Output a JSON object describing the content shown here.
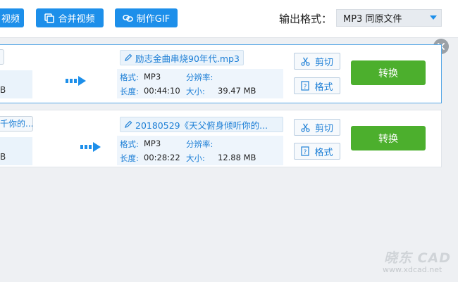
{
  "toolbar": {
    "split_video_label": "视频",
    "merge_video_label": "合并视频",
    "make_gif_label": "制作GIF",
    "output_format_label": "输出格式：",
    "output_format_value": "MP3  同原文件"
  },
  "tasks": [
    {
      "source_size_suffix": "B",
      "source_name": "",
      "output_name": "励志金曲串烧90年代.mp3",
      "format_key": "格式:",
      "format_value": "MP3",
      "resolution_key": "分辨率:",
      "resolution_value": "",
      "duration_key": "长度:",
      "duration_value": "00:44:10",
      "size_key": "大小:",
      "size_value": "39.47 MB",
      "cut_label": "剪切",
      "format_btn_label": "格式",
      "convert_label": "转换"
    },
    {
      "source_size_suffix": "B",
      "source_name": "千你的...",
      "output_name": "20180529《天父俯身倾听你的...",
      "format_key": "格式:",
      "format_value": "MP3",
      "resolution_key": "分辨率:",
      "resolution_value": "",
      "duration_key": "长度:",
      "duration_value": "00:28:22",
      "size_key": "大小:",
      "size_value": "12.88 MB",
      "cut_label": "剪切",
      "format_btn_label": "格式",
      "convert_label": "转换"
    }
  ],
  "watermark": {
    "brand": "晓东 CAD",
    "url": "www.xdcad.net"
  },
  "colors": {
    "accent": "#1d8fea",
    "convert": "#4caf2d"
  }
}
